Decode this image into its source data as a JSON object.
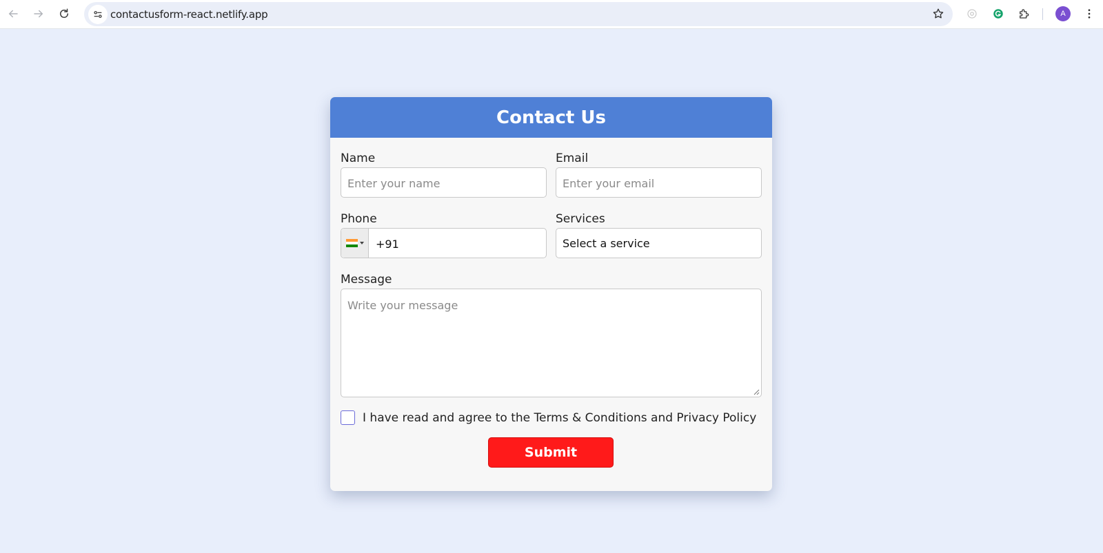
{
  "browser": {
    "url": "contactusform-react.netlify.app",
    "profile_initial": "A",
    "icons": [
      "back-icon",
      "forward-icon",
      "reload-icon",
      "site-info-icon",
      "bookmark-star-icon",
      "extension-icon",
      "grammarly-icon",
      "puzzle-icon",
      "menu-kebab-icon"
    ]
  },
  "form": {
    "title": "Contact Us",
    "name": {
      "label": "Name",
      "placeholder": "Enter your name"
    },
    "email": {
      "label": "Email",
      "placeholder": "Enter your email"
    },
    "phone": {
      "label": "Phone",
      "country_code": "+91",
      "flag": "india-flag-icon"
    },
    "services": {
      "label": "Services",
      "selected": "Select a service"
    },
    "message": {
      "label": "Message",
      "placeholder": "Write your message"
    },
    "agree_text": "I have read and agree to the Terms & Conditions and Privacy Policy",
    "agree_checked": false,
    "submit_label": "Submit"
  },
  "colors": {
    "page_bg": "#e8eefb",
    "header_bg": "#4f80d6",
    "submit_bg": "#ff1a1a",
    "card_bg": "#f7f7f7",
    "avatar_bg": "#7a4fd1"
  }
}
